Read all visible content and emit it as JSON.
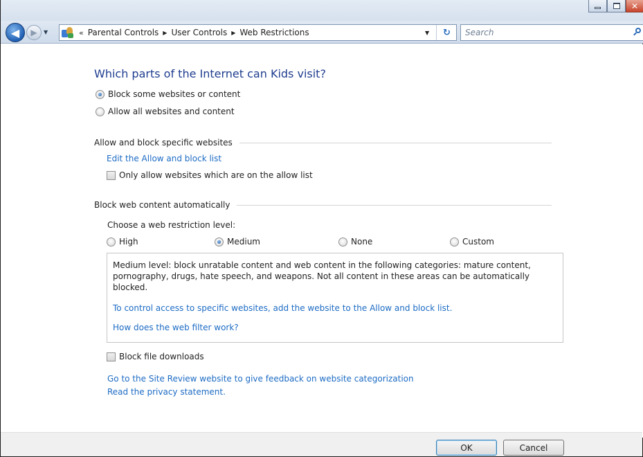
{
  "navigation": {
    "breadcrumb": [
      "Parental Controls",
      "User Controls",
      "Web Restrictions"
    ],
    "overflow_glyph": "«",
    "search_placeholder": "Search"
  },
  "content": {
    "heading": "Which parts of the Internet can Kids visit?",
    "access_options": [
      {
        "label": "Block some websites or content",
        "checked": true
      },
      {
        "label": "Allow all websites and content",
        "checked": false
      }
    ],
    "allow_block_section": {
      "title": "Allow and block specific websites",
      "edit_link": "Edit the Allow and block list",
      "only_allow_checkbox": {
        "label": "Only allow websites which are on the allow list",
        "checked": false
      }
    },
    "auto_block_section": {
      "title": "Block web content automatically",
      "level_prompt": "Choose a web restriction level:",
      "levels": [
        {
          "label": "High",
          "checked": false
        },
        {
          "label": "Medium",
          "checked": true
        },
        {
          "label": "None",
          "checked": false
        },
        {
          "label": "Custom",
          "checked": false
        }
      ],
      "level_description": "Medium level:  block unratable content and web content in the following categories:  mature content, pornography, drugs, hate speech, and weapons.  Not all content in these areas can be automatically blocked.",
      "control_access_link": "To control access to specific websites, add the website to the Allow and block list.",
      "filter_help_link": "How does the web filter work?"
    },
    "block_downloads_checkbox": {
      "label": "Block file downloads",
      "checked": false
    },
    "site_review_link": "Go to the Site Review website to give feedback on website categorization",
    "privacy_link": "Read the privacy statement."
  },
  "footer": {
    "ok_label": "OK",
    "cancel_label": "Cancel"
  },
  "colors": {
    "heading": "#1e3d8f",
    "link": "#1c6bc4",
    "chrome": "#d6e1ee"
  },
  "icons": [
    "back-arrow-icon",
    "forward-arrow-icon",
    "recent-pages-dropdown-icon",
    "control-panel-icon",
    "refresh-icon",
    "search-icon",
    "minimize-icon",
    "maximize-icon",
    "close-icon"
  ]
}
